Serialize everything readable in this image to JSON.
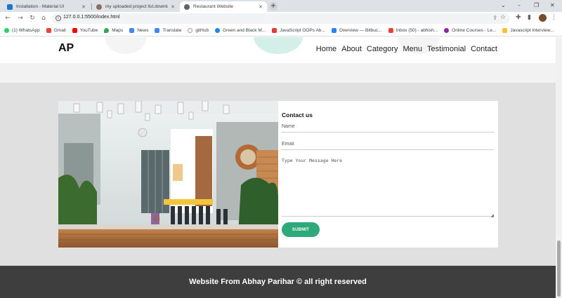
{
  "browser": {
    "tabs": [
      {
        "title": "Installation - Material UI",
        "active": false,
        "favicon_color": "#1976d2"
      },
      {
        "title": "my uploaded project list.downlo",
        "active": false,
        "favicon_color": "#8d6e63"
      },
      {
        "title": "Restaurant Website",
        "active": true,
        "favicon_color": "#5f6368"
      }
    ],
    "new_tab_label": "+",
    "url": "127.0.0.1:5500/index.html",
    "bookmarks": [
      {
        "label": "(1) WhatsApp",
        "color": "#25d366"
      },
      {
        "label": "Gmail",
        "color": "#ea4335"
      },
      {
        "label": "YouTube",
        "color": "#ff0000"
      },
      {
        "label": "Maps",
        "color": "#34a853"
      },
      {
        "label": "News",
        "color": "#4285f4"
      },
      {
        "label": "Translate",
        "color": "#4285f4"
      },
      {
        "label": "gitHub",
        "color": "#9e9e9e"
      },
      {
        "label": "Green and Black M...",
        "color": "#1e88e5"
      },
      {
        "label": "JavaScript OOPs Ab...",
        "color": "#e53935"
      },
      {
        "label": "Overview — Bitbuc...",
        "color": "#2684ff"
      },
      {
        "label": "Inbox (50) - abhish...",
        "color": "#ea4335"
      },
      {
        "label": "Online Courses - Le...",
        "color": "#8e24aa"
      },
      {
        "label": "Javascript Interview...",
        "color": "#fbc02d"
      }
    ]
  },
  "site": {
    "logo": "AP",
    "nav": [
      "Home",
      "About",
      "Category",
      "Menu",
      "Testimonial",
      "Contact"
    ],
    "contact": {
      "heading": "Contact us",
      "name_placeholder": "Name",
      "email_placeholder": "Email",
      "message_placeholder": "Type Your Message Here",
      "submit_label": "SUBMIT"
    },
    "footer_text": "Website From Abhay Parihar © all right reserved"
  },
  "colors": {
    "accent": "#2eaa7a",
    "footer_bg": "#3e3e3e",
    "page_bg": "#e0e0e0"
  }
}
